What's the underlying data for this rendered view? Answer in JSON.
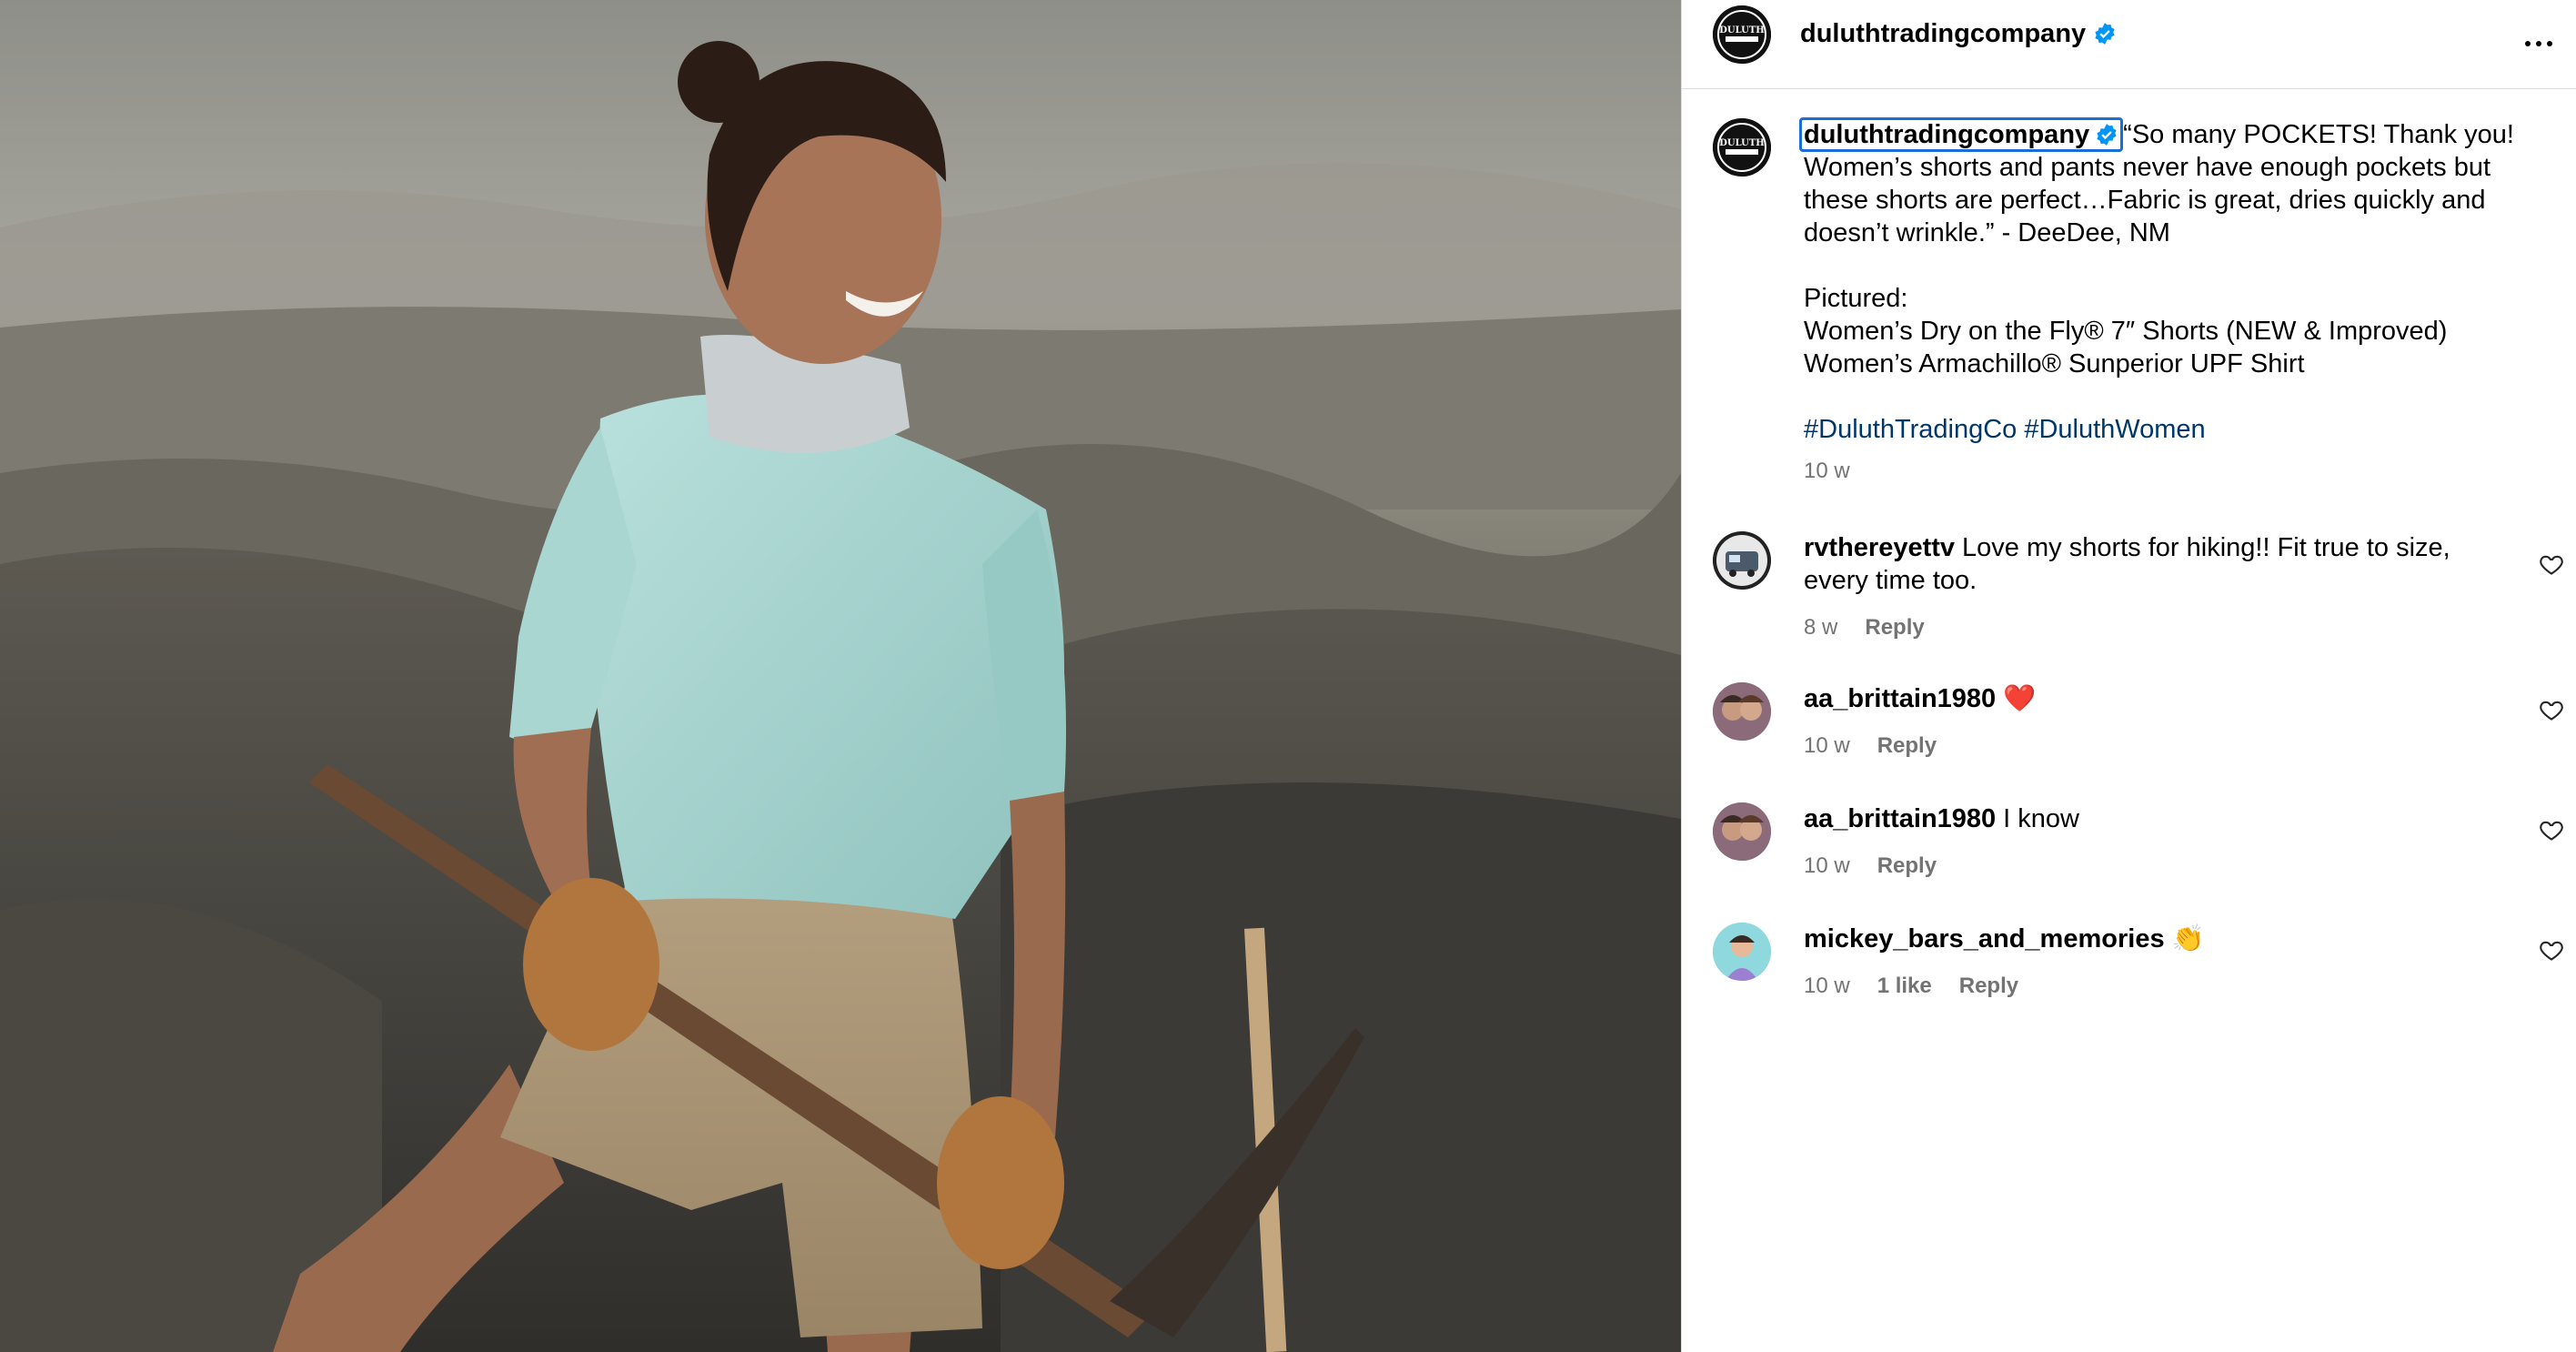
{
  "post": {
    "author": "duluthtradingcompany",
    "author_verified": true,
    "caption_lines": [
      "“So many POCKETS! Thank you!",
      "Women’s shorts and pants never have enough pockets but",
      "these shorts are perfect…Fabric is great, dries quickly and",
      "doesn’t wrinkle.” - DeeDee, NM",
      "",
      "Pictured:",
      "Women’s Dry on the Fly® 7″ Shorts (NEW & Improved)",
      "Women’s Armachillo® Sunperior UPF Shirt"
    ],
    "hashtags": [
      "#DuluthTradingCo",
      "#DuluthWomen"
    ],
    "age": "10 w",
    "logo_text": "DULUTH"
  },
  "comments": [
    {
      "user": "rvthereyettv",
      "text": "Love my shorts for hiking!! Fit true to size,",
      "text2": "every time too.",
      "age": "8 w",
      "likes": "",
      "reply": "Reply",
      "avatar_color": "#2b2b2b",
      "avatar_text": "RV THERE YET?"
    },
    {
      "user": "aa_brittain1980",
      "text": "❤️",
      "text2": "",
      "age": "10 w",
      "likes": "",
      "reply": "Reply",
      "avatar_color": "#7a5a6a",
      "avatar_text": ""
    },
    {
      "user": "aa_brittain1980",
      "text": "I know",
      "text2": "",
      "age": "10 w",
      "likes": "",
      "reply": "Reply",
      "avatar_color": "#7a5a6a",
      "avatar_text": ""
    },
    {
      "user": "mickey_bars_and_memories",
      "text": "👏",
      "text2": "",
      "age": "10 w",
      "likes": "1 like",
      "reply": "Reply",
      "avatar_color": "#7fd0d8",
      "avatar_text": ""
    }
  ],
  "colors": {
    "verified": "#0095f6",
    "link": "#00376b",
    "muted": "#737373",
    "focus": "#1a6ed8"
  }
}
